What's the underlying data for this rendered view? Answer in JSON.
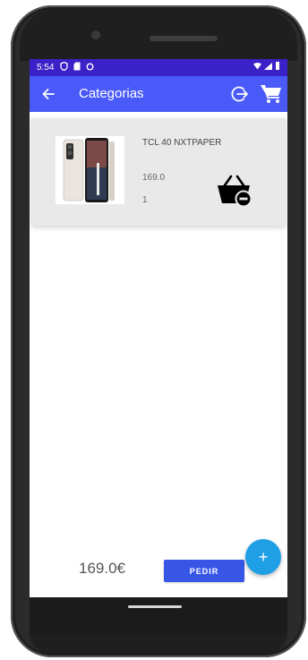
{
  "status_bar": {
    "time": "5:54"
  },
  "app_bar": {
    "title": "Categorias"
  },
  "cart_items": [
    {
      "name": "TCL 40 NXTPAPER",
      "price": "169.0",
      "quantity": "1"
    }
  ],
  "footer": {
    "total": "169.0€",
    "order_label": "PEDIR",
    "fab_label": "+"
  },
  "icons": {
    "back": "arrow-left-icon",
    "logout": "logout-icon",
    "cart": "shopping-cart-icon",
    "remove_basket": "basket-remove-icon"
  },
  "colors": {
    "status_bar": "#3a21c8",
    "app_bar": "#4a5af8",
    "card_background": "#e9e9e9",
    "order_button": "#3856e6",
    "fab": "#1e9fe6"
  }
}
